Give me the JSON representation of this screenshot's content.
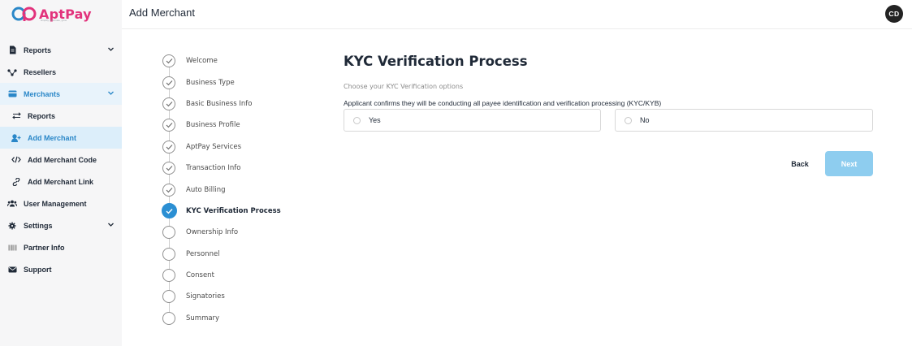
{
  "app": {
    "logo_text": "AptPay",
    "logo_tagline": "simplify, automate, grow",
    "brand_color": "#e2337c",
    "accent_color": "#2b8fd3"
  },
  "header": {
    "title": "Add Merchant",
    "avatar_initials": "CD"
  },
  "sidebar": {
    "items": [
      {
        "label": "Reports",
        "icon": "document-icon",
        "has_chevron": true
      },
      {
        "label": "Resellers",
        "icon": "network-icon",
        "has_chevron": false
      },
      {
        "label": "Merchants",
        "icon": "card-icon",
        "has_chevron": true,
        "active": true
      },
      {
        "label": "Reports",
        "icon": "arrows-icon",
        "sub": true
      },
      {
        "label": "Add Merchant",
        "icon": "add-user-icon",
        "sub": true,
        "current": true
      },
      {
        "label": "Add Merchant Code",
        "icon": "code-icon",
        "sub": true
      },
      {
        "label": "Add Merchant Link",
        "icon": "link-icon",
        "sub": true
      },
      {
        "label": "User Management",
        "icon": "users-icon",
        "has_chevron": false
      },
      {
        "label": "Settings",
        "icon": "gear-icon",
        "has_chevron": true
      },
      {
        "label": "Partner Info",
        "icon": "barcode-icon",
        "has_chevron": false
      },
      {
        "label": "Support",
        "icon": "mail-icon",
        "has_chevron": false
      }
    ]
  },
  "stepper": {
    "steps": [
      {
        "label": "Welcome",
        "status": "done"
      },
      {
        "label": "Business Type",
        "status": "done"
      },
      {
        "label": "Basic Business Info",
        "status": "done"
      },
      {
        "label": "Business Profile",
        "status": "done"
      },
      {
        "label": "AptPay Services",
        "status": "done"
      },
      {
        "label": "Transaction Info",
        "status": "done"
      },
      {
        "label": "Auto Billing",
        "status": "done"
      },
      {
        "label": "KYC Verification Process",
        "status": "current"
      },
      {
        "label": "Ownership Info",
        "status": "todo"
      },
      {
        "label": "Personnel",
        "status": "todo"
      },
      {
        "label": "Consent",
        "status": "todo"
      },
      {
        "label": "Signatories",
        "status": "todo"
      },
      {
        "label": "Summary",
        "status": "todo"
      }
    ]
  },
  "main": {
    "title": "KYC Verification Process",
    "subtitle": "Choose your KYC Verification options",
    "question": "Applicant confirms they will be conducting all payee identification and verification processing (KYC/KYB)",
    "options": [
      {
        "label": "Yes",
        "selected": false
      },
      {
        "label": "No",
        "selected": false
      }
    ],
    "back_label": "Back",
    "next_label": "Next"
  }
}
